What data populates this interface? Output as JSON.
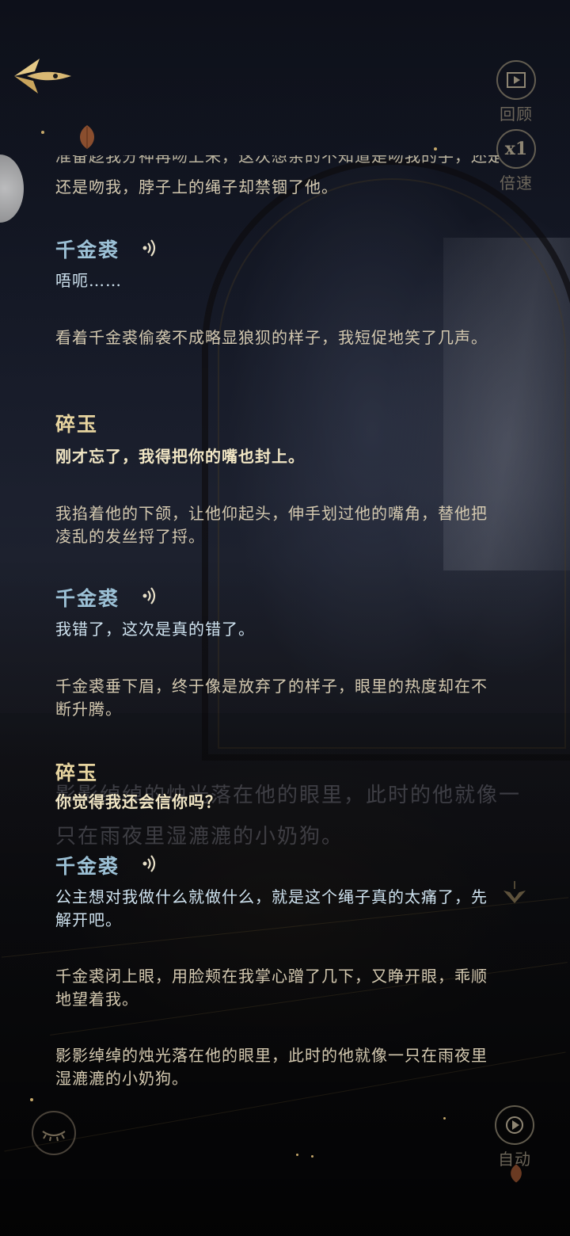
{
  "controls": {
    "review": {
      "label": "回顾",
      "icon": "review-play-icon"
    },
    "speed": {
      "label": "倍速",
      "value": "x1"
    },
    "auto": {
      "label": "自动",
      "icon": "auto-play-icon"
    },
    "back_icon": "back-arrow-icon",
    "hide_ui_icon": "eye-closed-icon"
  },
  "dialogue": {
    "cut_line": "准备趁我分神再吻上来，这次想亲的不知道是吻我的手，还是想吻我",
    "line0": "还是吻我，脖子上的绳子却禁锢了他。",
    "entries": [
      {
        "speaker": "千金裘",
        "text": "唔呃……"
      },
      {
        "narration": "看着千金裘偷袭不成略显狼狈的样子，我短促地笑了几声。"
      },
      {
        "speaker": "碎玉",
        "text": "刚才忘了，我得把你的嘴也封上。"
      },
      {
        "narration": "我掐着他的下颌，让他仰起头，伸手划过他的嘴角，替他把凌乱的发丝捋了捋。"
      },
      {
        "speaker": "千金裘",
        "text": "我错了，这次是真的错了。"
      },
      {
        "narration": "千金裘垂下眉，终于像是放弃了的样子，眼里的热度却在不断升腾。"
      },
      {
        "speaker": "碎玉",
        "text": "你觉得我还会信你吗？"
      },
      {
        "speaker": "千金裘",
        "text": "公主想对我做什么就做什么，就是这个绳子真的太痛了，先解开吧。"
      },
      {
        "narration": "千金裘闭上眼，用脸颊在我掌心蹭了几下，又睁开眼，乖顺地望着我。"
      },
      {
        "narration": "影影绰绰的烛光落在他的眼里，此时的他就像一只在雨夜里湿漉漉的小奶狗。"
      }
    ],
    "ghost_text": "影影绰绰的烛光落在他的眼里，此时的他就像一只在雨夜里湿漉漉的小奶狗。"
  },
  "colors": {
    "speaker_male": "#9cc1d6",
    "speaker_player": "#e7d49f",
    "accent_gold": "#c6a86a"
  }
}
